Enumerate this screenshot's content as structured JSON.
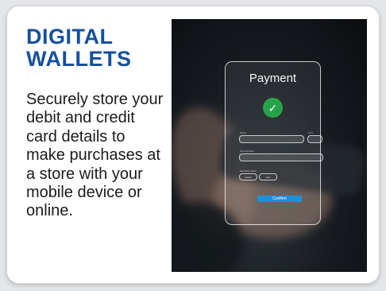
{
  "card": {
    "heading": "DIGITAL WALLETS",
    "description": "Securely store your debit and credit card details to make purchases at a store with your mobile device or online."
  },
  "payment_screen": {
    "title": "Payment",
    "check_symbol": "✓",
    "fields": {
      "name_label": "Name",
      "cvv_label": "CVV",
      "card_number_label": "Card Number",
      "expiration_label": "Expiration Date",
      "month_option": "month",
      "year_option": "year"
    },
    "confirm_label": "Confirm"
  },
  "colors": {
    "heading": "#16509e",
    "success": "#27a44b",
    "confirm_button": "#1e90d8"
  }
}
